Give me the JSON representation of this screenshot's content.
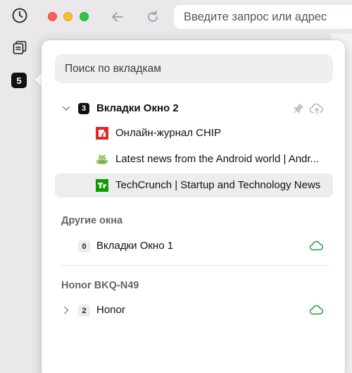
{
  "rail": {
    "history_icon": "clock-icon",
    "tabs_icon": "tabs-stack-icon",
    "tab_count": "5"
  },
  "toolbar": {
    "back_icon": "back-arrow-icon",
    "reload_icon": "reload-icon",
    "address_placeholder": "Введите запрос или адрес"
  },
  "panel": {
    "search_placeholder": "Поиск по вкладкам",
    "current_window": {
      "count": "3",
      "title": "Вкладки Окно 2",
      "tabs": [
        {
          "title": "Онлайн-журнал CHIP",
          "favicon": "chip-favicon",
          "color": "#e4252b"
        },
        {
          "title": "Latest news from the Android world | Andr...",
          "favicon": "android-favicon",
          "color": "#7ab648"
        },
        {
          "title": "TechCrunch | Startup and Technology News",
          "favicon": "techcrunch-favicon",
          "color": "#0a9e01",
          "active": true
        }
      ]
    },
    "other_windows_label": "Другие окна",
    "other_windows": [
      {
        "count": "0",
        "title": "Вкладки Окно 1"
      }
    ],
    "device_label": "Honor BKQ-N49",
    "device_groups": [
      {
        "count": "2",
        "title": "Honor"
      }
    ]
  },
  "colors": {
    "cloud_green": "#21a038",
    "icon_grey": "#b5b5b8"
  }
}
